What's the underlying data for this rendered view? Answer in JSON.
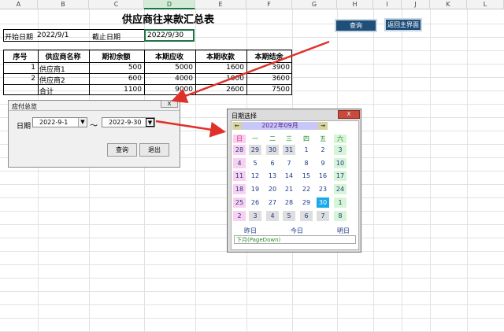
{
  "columns": [
    "A",
    "B",
    "C",
    "D",
    "E",
    "F",
    "G",
    "H",
    "I",
    "J",
    "K",
    "L"
  ],
  "sheet": {
    "title": "供应商往来款汇总表",
    "start_label": "开始日期",
    "start_value": "2022/9/1",
    "end_label": "截止日期",
    "end_value": "2022/9/30",
    "headers": [
      "序号",
      "供应商名称",
      "期初余额",
      "本期应收",
      "本期收款",
      "本期结余"
    ],
    "rows": [
      [
        "1",
        "供应商1",
        "500",
        "5000",
        "1600",
        "3900"
      ],
      [
        "2",
        "供应商2",
        "600",
        "4000",
        "1000",
        "3600"
      ],
      [
        "",
        "合计",
        "1100",
        "9000",
        "2600",
        "7500"
      ]
    ]
  },
  "buttons": {
    "query": "查询",
    "home": "返回主界面"
  },
  "filter_dialog": {
    "title": "应付总览",
    "close": "X",
    "date_label": "日期",
    "from": "2022-9-1",
    "tilde": "～",
    "to": "2022-9-30",
    "arrow": "▼",
    "query": "查询",
    "exit": "退出"
  },
  "calendar": {
    "title": "日期选择",
    "close": "X",
    "month": "2022年09月",
    "prev": "←",
    "next": "→",
    "weekdays": [
      "日",
      "一",
      "二",
      "三",
      "四",
      "五",
      "六"
    ],
    "weeks": [
      [
        "28",
        "29",
        "30",
        "31",
        "1",
        "2",
        "3"
      ],
      [
        "4",
        "5",
        "6",
        "7",
        "8",
        "9",
        "10"
      ],
      [
        "11",
        "12",
        "13",
        "14",
        "15",
        "16",
        "17"
      ],
      [
        "18",
        "19",
        "20",
        "21",
        "22",
        "23",
        "24"
      ],
      [
        "25",
        "26",
        "27",
        "28",
        "29",
        "30",
        "1"
      ],
      [
        "2",
        "3",
        "4",
        "5",
        "6",
        "7",
        "8"
      ]
    ],
    "selected_day": "30",
    "yesterday": "昨日",
    "today": "今日",
    "tomorrow": "明日",
    "hint": "下月(PageDown)",
    "colors": {
      "sunday": "#f9d0f0",
      "saturday": "#d6f5d6",
      "weekday": "#dedede",
      "selected": "#1aa9e8",
      "header": "#c8c8f8"
    }
  }
}
